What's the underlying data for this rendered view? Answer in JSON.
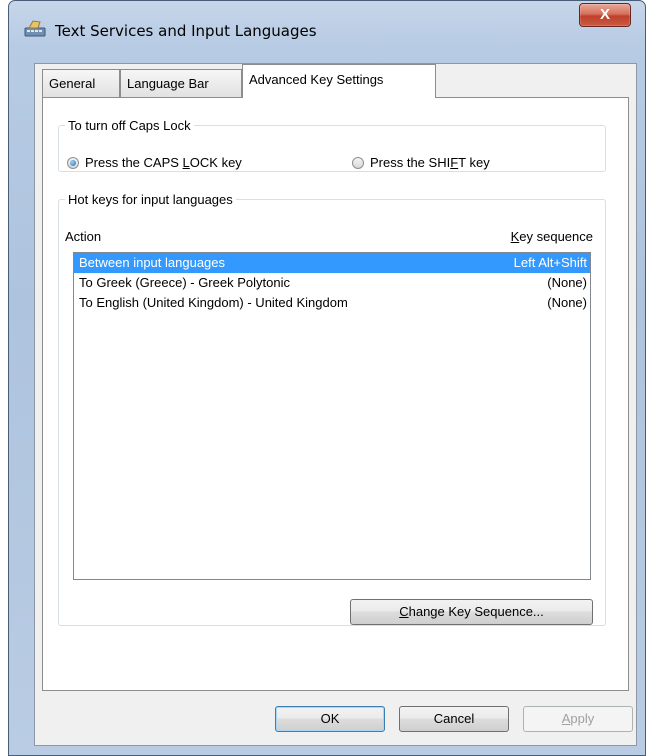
{
  "window": {
    "title": "Text Services and Input Languages",
    "close_label": "X"
  },
  "tabs": [
    {
      "label": "General",
      "active": false
    },
    {
      "label": "Language Bar",
      "active": false
    },
    {
      "label": "Advanced Key Settings",
      "active": true
    }
  ],
  "caps_lock": {
    "legend": "To turn off Caps Lock",
    "options": [
      {
        "label_before": "Press the CAPS ",
        "mnemonic": "L",
        "label_after": "OCK key",
        "checked": true
      },
      {
        "label_before": "Press the SHI",
        "mnemonic": "F",
        "label_after": "T key",
        "checked": false
      }
    ]
  },
  "hotkeys": {
    "legend": "Hot keys for input languages",
    "col_action": "Action",
    "col_keyseq_mnemonic": "K",
    "col_keyseq_rest": "ey sequence",
    "rows": [
      {
        "action": "Between input languages",
        "keys": "Left Alt+Shift",
        "selected": true
      },
      {
        "action": "To Greek (Greece) - Greek Polytonic",
        "keys": "(None)",
        "selected": false
      },
      {
        "action": "To English (United Kingdom) - United Kingdom",
        "keys": "(None)",
        "selected": false
      }
    ],
    "change_button": {
      "mnemonic": "C",
      "rest": "hange Key Sequence..."
    }
  },
  "footer": {
    "ok": "OK",
    "cancel": "Cancel",
    "apply_mnemonic": "A",
    "apply_rest": "pply"
  },
  "colors": {
    "selection": "#3399ff",
    "close_button": "#c0402b",
    "frame": "#b7cbe4"
  },
  "icons": {
    "app_icon": "keyboard-icon"
  }
}
